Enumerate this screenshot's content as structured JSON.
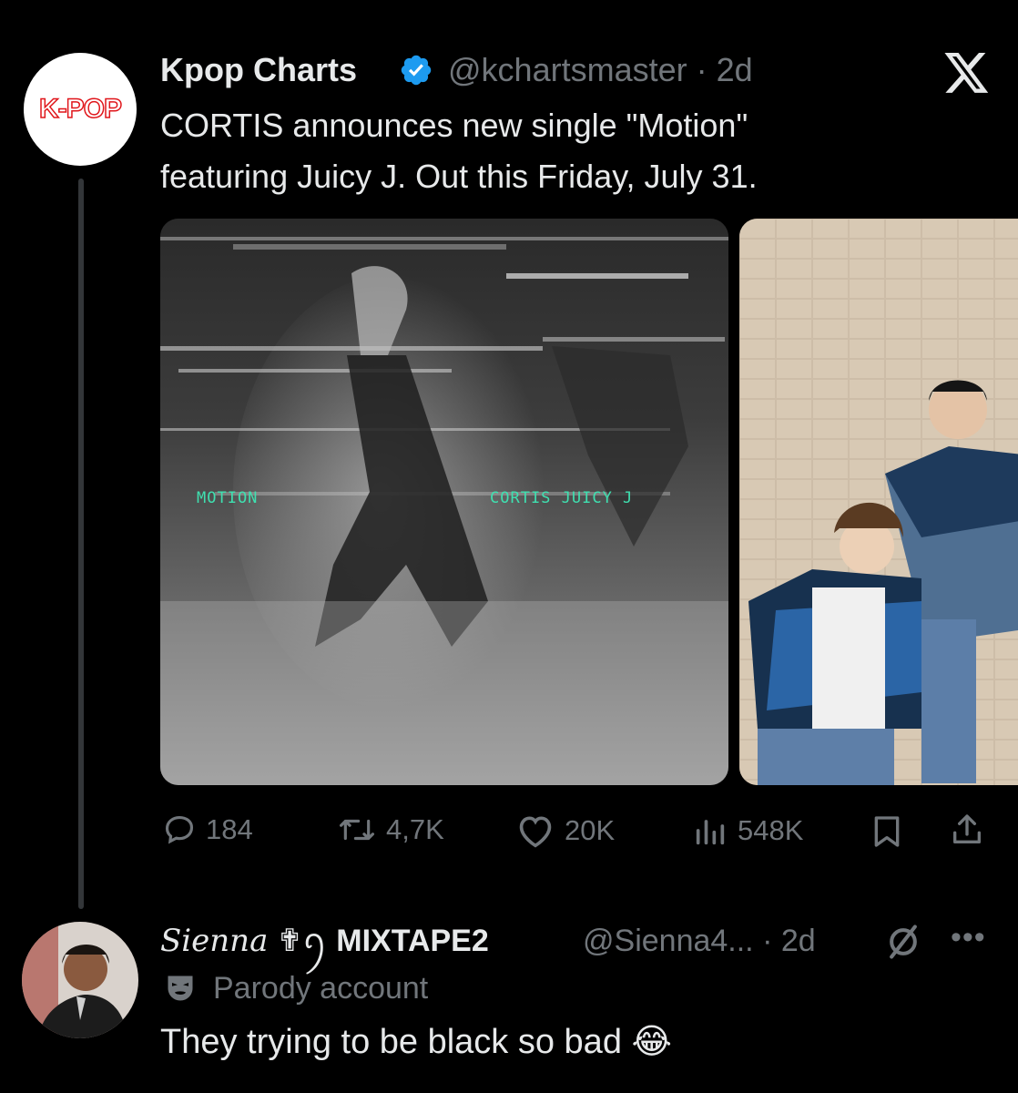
{
  "tweet": {
    "author_name": "Kpop Charts",
    "handle_and_time": "@kchartsmaster · 2d",
    "avatar_logo_text": "K-POP",
    "text_lines": [
      "CORTIS announces new single \"Motion\"",
      "featuring Juicy J. Out this Friday, July 31."
    ],
    "media": [
      {
        "kind": "album-cover",
        "overlay_left": "MOTION",
        "overlay_right": "CORTIS JUICY J"
      },
      {
        "kind": "photo"
      }
    ],
    "stats": {
      "replies": "184",
      "reposts": "4,7K",
      "likes": "20K",
      "views": "548K"
    }
  },
  "reply": {
    "display_name_script": "Sienna",
    "display_name_symbols": "✟ꪆ",
    "display_name_bold": "MIXTAPE2",
    "handle_and_time": "@Sienna4... · 2d",
    "label": "Parody account",
    "text": "They trying to be black so bad",
    "emoji": "😂"
  },
  "colors": {
    "background": "#000000",
    "text": "#e7e9ea",
    "muted": "#71767b",
    "verified": "#1d9bf0",
    "brand_red": "#e0161b"
  },
  "icons": [
    "verified-icon",
    "x-logo-icon",
    "reply-icon",
    "repost-icon",
    "like-icon",
    "views-icon",
    "bookmark-icon",
    "share-icon",
    "muted-icon",
    "more-icon",
    "parody-mask-icon"
  ]
}
